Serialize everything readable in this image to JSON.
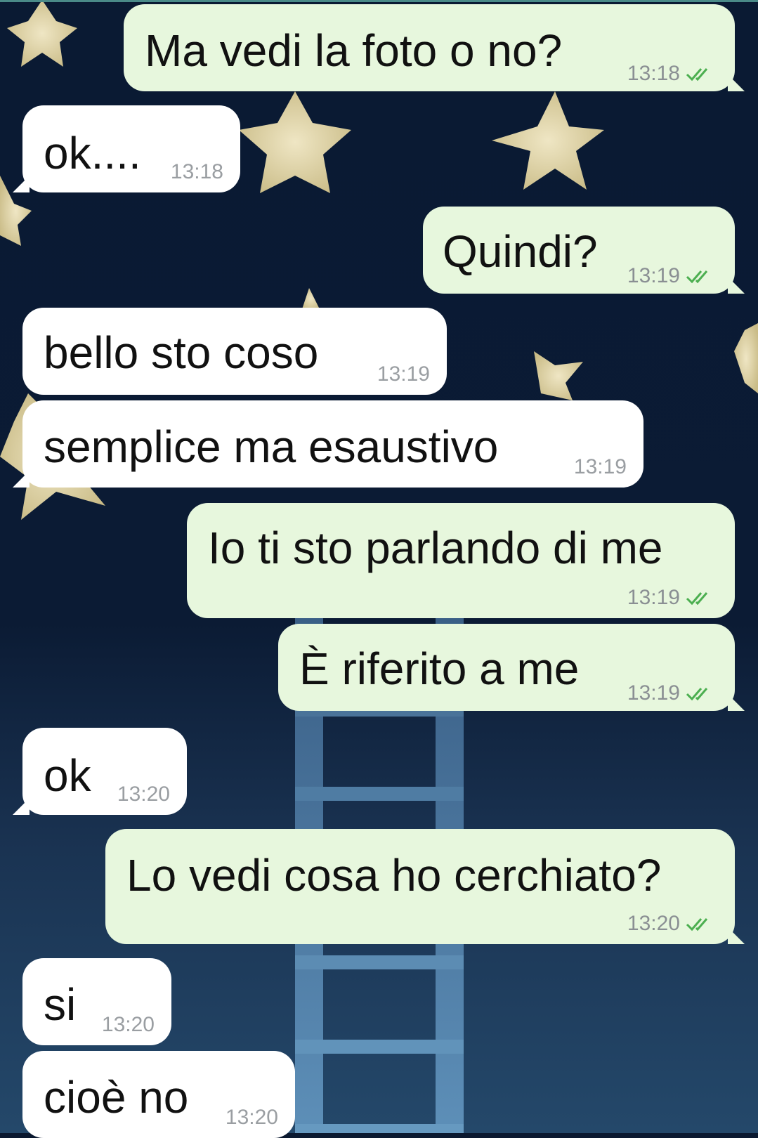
{
  "colors": {
    "outgoing_bubble": "#e7f7dd",
    "incoming_bubble": "#ffffff",
    "read_tick": "#4caf50",
    "timestamp": "#8a8f93",
    "wallpaper": "#0b1930"
  },
  "icons": {
    "read_receipt": "double-check-icon"
  },
  "messages": [
    {
      "dir": "out",
      "text": "Ma vedi la foto o no?",
      "time": "13:18",
      "read": true
    },
    {
      "dir": "in",
      "text": "ok....",
      "time": "13:18"
    },
    {
      "dir": "out",
      "text": "Quindi?",
      "time": "13:19",
      "read": true
    },
    {
      "dir": "in",
      "text": "bello sto coso",
      "time": "13:19"
    },
    {
      "dir": "in",
      "text": "semplice ma esaustivo",
      "time": "13:19"
    },
    {
      "dir": "out",
      "text": "Io ti sto parlando di me",
      "time": "13:19",
      "read": true
    },
    {
      "dir": "out",
      "text": "È riferito a me",
      "time": "13:19",
      "read": true
    },
    {
      "dir": "in",
      "text": "ok",
      "time": "13:20"
    },
    {
      "dir": "out",
      "text": "Lo vedi cosa ho cerchiato?",
      "time": "13:20",
      "read": true
    },
    {
      "dir": "in",
      "text": "si",
      "time": "13:20"
    },
    {
      "dir": "in",
      "text": "cioè no",
      "time": "13:20"
    }
  ]
}
